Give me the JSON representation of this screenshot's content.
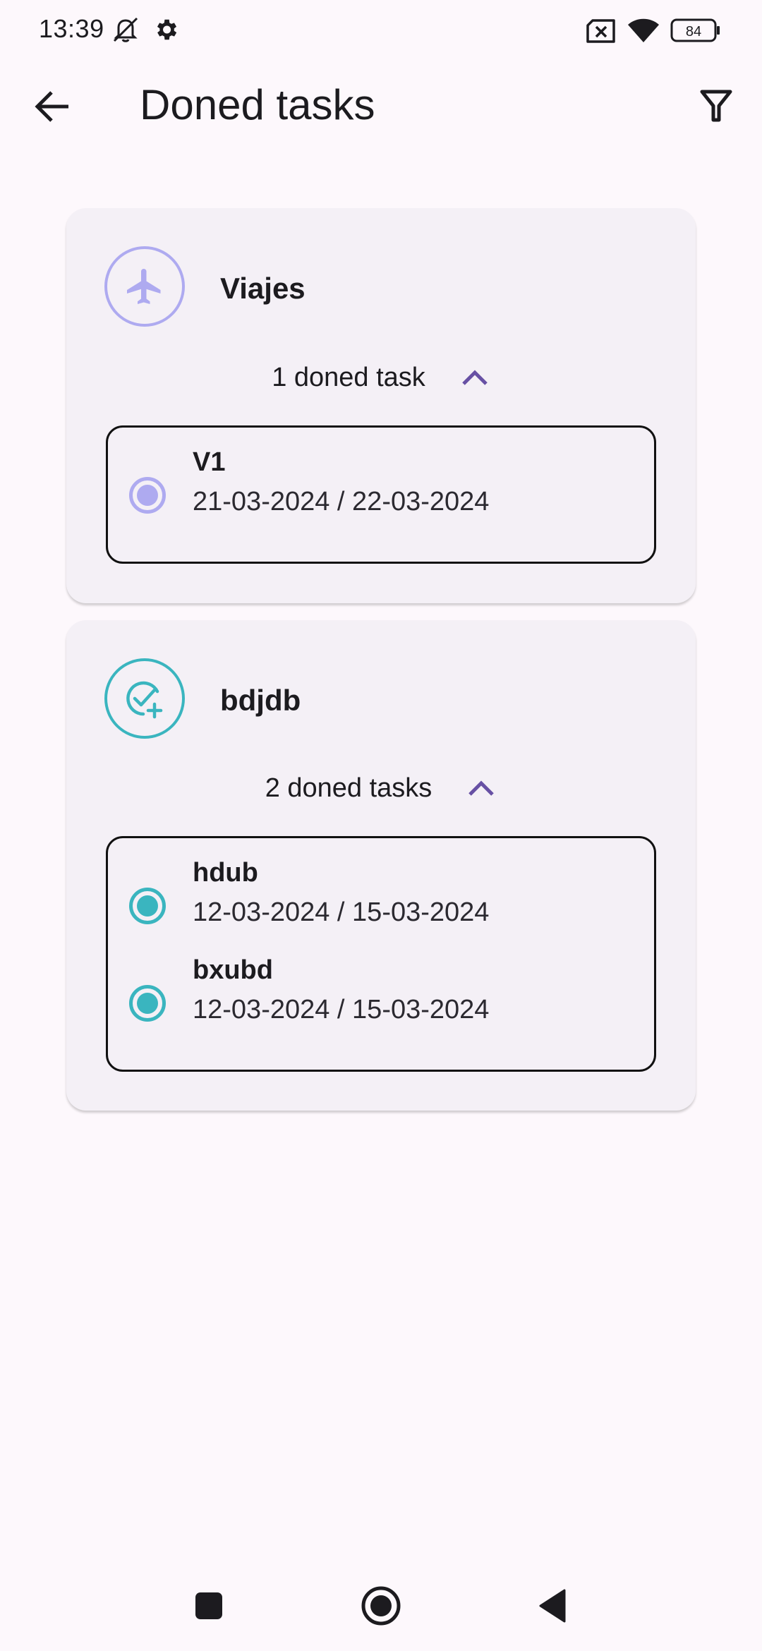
{
  "status_bar": {
    "time": "13:39",
    "battery": "84"
  },
  "app_bar": {
    "title": "Doned tasks"
  },
  "categories": [
    {
      "name": "Viajes",
      "icon": "airplane-icon",
      "color": "#aeaaf0",
      "count_label": "1 doned task",
      "tasks": [
        {
          "name": "V1",
          "dates": "21-03-2024 / 22-03-2024"
        }
      ]
    },
    {
      "name": "bdjdb",
      "icon": "task-check-add-icon",
      "color": "#3ab5bf",
      "count_label": "2 doned tasks",
      "tasks": [
        {
          "name": "hdub",
          "dates": "12-03-2024 / 15-03-2024"
        },
        {
          "name": "bxubd",
          "dates": "12-03-2024 / 15-03-2024"
        }
      ]
    }
  ],
  "colors": {
    "background": "#fdf8fc",
    "card": "#f4f0f6",
    "accent_purple": "#6750a4"
  }
}
